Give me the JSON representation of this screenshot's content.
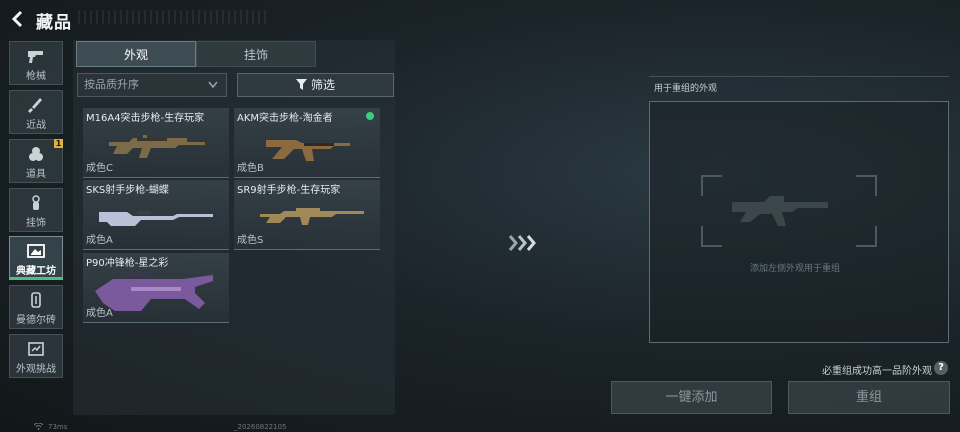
{
  "header": {
    "title": "藏品"
  },
  "nav": [
    {
      "label": "枪械",
      "icon": "pistol-icon",
      "active": false
    },
    {
      "label": "近战",
      "icon": "knife-icon",
      "active": false
    },
    {
      "label": "道具",
      "icon": "grenade-icon",
      "active": false,
      "badge": "1"
    },
    {
      "label": "挂饰",
      "icon": "charm-icon",
      "active": false
    },
    {
      "label": "典藏工坊",
      "icon": "workshop-icon",
      "active": true
    },
    {
      "label": "曼德尔砖",
      "icon": "brick-icon",
      "active": false
    },
    {
      "label": "外观挑战",
      "icon": "challenge-icon",
      "active": false
    }
  ],
  "tabs": [
    {
      "label": "外观",
      "active": true
    },
    {
      "label": "挂饰",
      "active": false
    }
  ],
  "sort": {
    "label": "按品质升序"
  },
  "filter": {
    "label": "筛选"
  },
  "items": [
    {
      "name": "M16A4突击步枪-生存玩家",
      "grade": "成色C"
    },
    {
      "name": "AKM突击步枪-淘金者",
      "grade": "成色B",
      "status_color": "#38d07a"
    },
    {
      "name": "SKS射手步枪-蝴蝶",
      "grade": "成色A"
    },
    {
      "name": "SR9射手步枪-生存玩家",
      "grade": "成色S"
    },
    {
      "name": "P90冲锋枪-星之彩",
      "grade": "成色A"
    }
  ],
  "preview": {
    "title": "用于重组的外观",
    "hint": "添加左侧外观用于重组"
  },
  "promo_text": "必重组成功高一品阶外观",
  "help_label": "?",
  "buttons": {
    "add": "一键添加",
    "regroup": "重组"
  },
  "footer": {
    "ping": "73ms",
    "build": "_20260822105"
  },
  "colors": {
    "accent_green": "#4ec07c",
    "badge_yellow": "#e0b03a"
  }
}
